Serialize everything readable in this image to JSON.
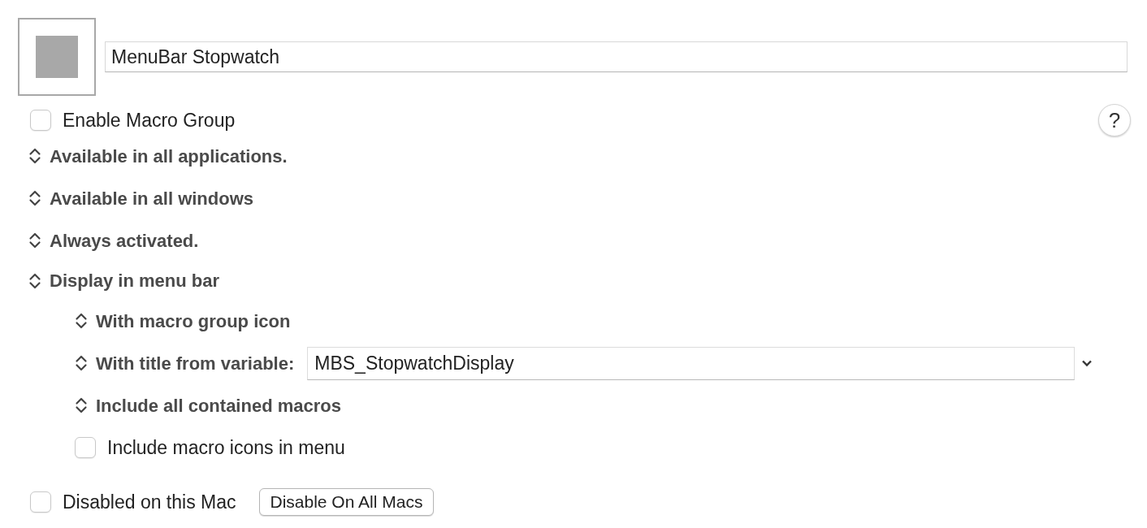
{
  "group_name": "MenuBar Stopwatch",
  "enable": {
    "label": "Enable Macro Group",
    "checked": false
  },
  "help": "?",
  "options": [
    {
      "kind": "popup",
      "label": "Available in all applications."
    },
    {
      "kind": "popup",
      "label": "Available in all windows"
    },
    {
      "kind": "popup",
      "label": "Always activated."
    },
    {
      "kind": "popup",
      "label": "Display in menu bar",
      "children": [
        {
          "kind": "popup",
          "label": "With macro group icon"
        },
        {
          "kind": "popup_field",
          "label": "With title from variable:",
          "value": "MBS_StopwatchDisplay"
        },
        {
          "kind": "popup",
          "label": "Include all contained macros"
        },
        {
          "kind": "checkbox",
          "label": "Include macro icons in menu",
          "checked": false
        }
      ]
    }
  ],
  "disabled_here": {
    "label": "Disabled on this Mac",
    "checked": false
  },
  "disable_all_button": "Disable On All Macs"
}
